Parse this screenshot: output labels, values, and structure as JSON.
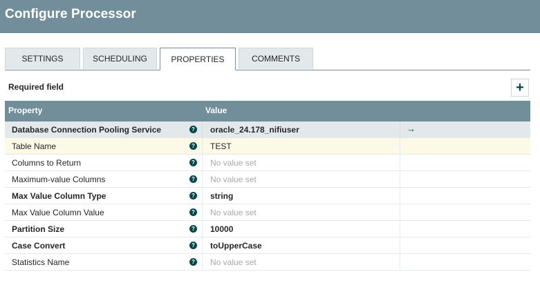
{
  "dialog": {
    "title": "Configure Processor"
  },
  "tabs": [
    {
      "label": "SETTINGS",
      "active": false
    },
    {
      "label": "SCHEDULING",
      "active": false
    },
    {
      "label": "PROPERTIES",
      "active": true
    },
    {
      "label": "COMMENTS",
      "active": false
    }
  ],
  "required_field_label": "Required field",
  "add_property_icon": "plus-icon",
  "grid": {
    "columns": {
      "property": "Property",
      "value": "Value"
    },
    "rows": [
      {
        "name": "Database Connection Pooling Service",
        "required": true,
        "value": "oracle_24.178_nifiuser",
        "value_set": true,
        "state": "selected",
        "goto_icon": "arrow-right-icon"
      },
      {
        "name": "Table Name",
        "required": false,
        "value": "TEST",
        "value_set": true,
        "state": "hover"
      },
      {
        "name": "Columns to Return",
        "required": false,
        "value": "No value set",
        "value_set": false
      },
      {
        "name": "Maximum-value Columns",
        "required": false,
        "value": "No value set",
        "value_set": false
      },
      {
        "name": "Max Value Column Type",
        "required": true,
        "value": "string",
        "value_set": true
      },
      {
        "name": "Max Value Column Value",
        "required": false,
        "value": "No value set",
        "value_set": false
      },
      {
        "name": "Partition Size",
        "required": true,
        "value": "10000",
        "value_set": true
      },
      {
        "name": "Case Convert",
        "required": true,
        "value": "toUpperCase",
        "value_set": true
      },
      {
        "name": "Statistics Name",
        "required": false,
        "value": "No value set",
        "value_set": false
      }
    ]
  },
  "colors": {
    "header_bg": "#728e9b",
    "accent": "#004849",
    "selected_row_bg": "#e3e8eb",
    "hover_row_bg": "#fcf9e6",
    "placeholder_text": "#a8a8a8"
  }
}
